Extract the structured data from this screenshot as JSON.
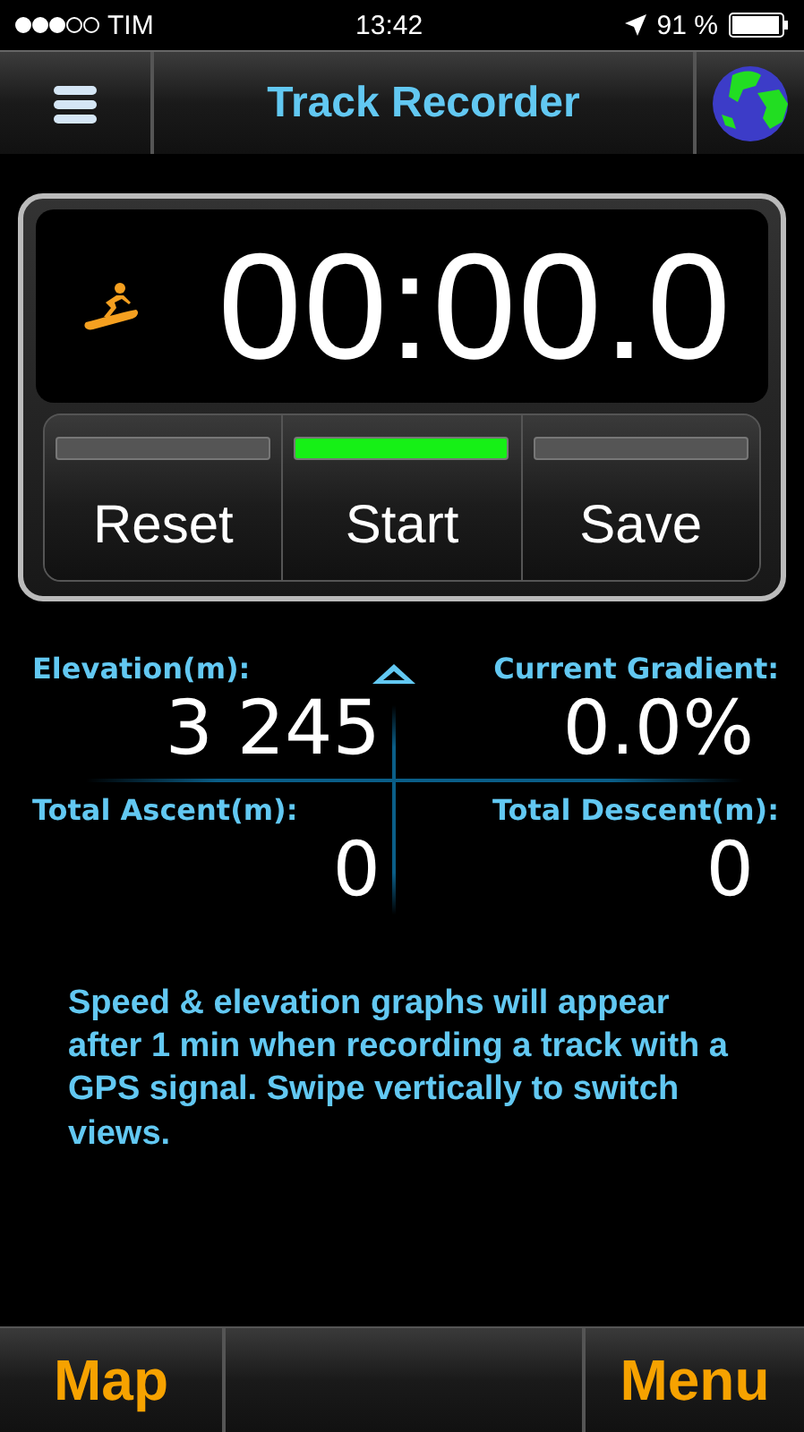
{
  "status_bar": {
    "carrier": "TIM",
    "time": "13:42",
    "battery": "91 %"
  },
  "nav_bar": {
    "title": "Track Recorder"
  },
  "timer": {
    "display": "00:00.0"
  },
  "timer_buttons": [
    {
      "label": "Reset",
      "lit": false
    },
    {
      "label": "Start",
      "lit": true
    },
    {
      "label": "Save",
      "lit": false
    }
  ],
  "stats": [
    {
      "label": "Elevation(m):",
      "value": "3 245"
    },
    {
      "label": "Current Gradient:",
      "value": "0.0%"
    },
    {
      "label": "Total Ascent(m):",
      "value": "0"
    },
    {
      "label": "Total Descent(m):",
      "value": "0"
    }
  ],
  "message": "Speed & elevation graphs will appear after 1 min when recording a track with a GPS signal. Swipe vertically to switch views.",
  "bottom_bar": {
    "left": "Map",
    "right": "Menu"
  }
}
